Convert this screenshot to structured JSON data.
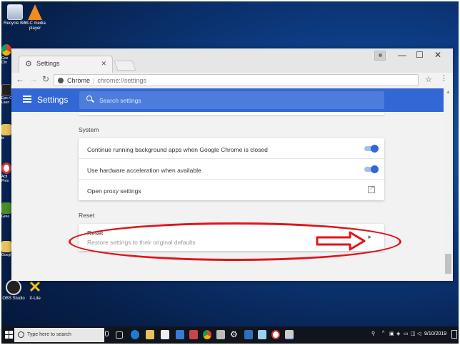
{
  "desktop": {
    "icons": [
      {
        "label": "Recycle Bin"
      },
      {
        "label": "VLC media player"
      },
      {
        "label": "OBS Studio"
      },
      {
        "label": "X-Lite"
      }
    ],
    "partial_labels": [
      "Goo Chr",
      "Epic G Laun",
      "te",
      "Acti Pres",
      "Gree",
      "Googl"
    ]
  },
  "window": {
    "tab_title": "Settings",
    "omnibox": {
      "site": "Chrome",
      "url": "chrome://settings"
    }
  },
  "settings": {
    "header_title": "Settings",
    "search_placeholder": "Search settings",
    "system_section": {
      "title": "System",
      "rows": [
        {
          "label": "Continue running background apps when Google Chrome is closed",
          "enabled": true
        },
        {
          "label": "Use hardware acceleration when available",
          "enabled": true
        },
        {
          "label": "Open proxy settings"
        }
      ]
    },
    "reset_section": {
      "title": "Reset",
      "row_label": "Reset",
      "row_sublabel": "Restore settings to their original defaults"
    }
  },
  "annotation": {
    "color": "#e0141b"
  },
  "taskbar": {
    "search_placeholder": "Type here to search",
    "clock": "9/10/2019"
  },
  "colors": {
    "accent": "#3367d6",
    "header": "#3367d6",
    "toggle_on": "#3367d6"
  }
}
